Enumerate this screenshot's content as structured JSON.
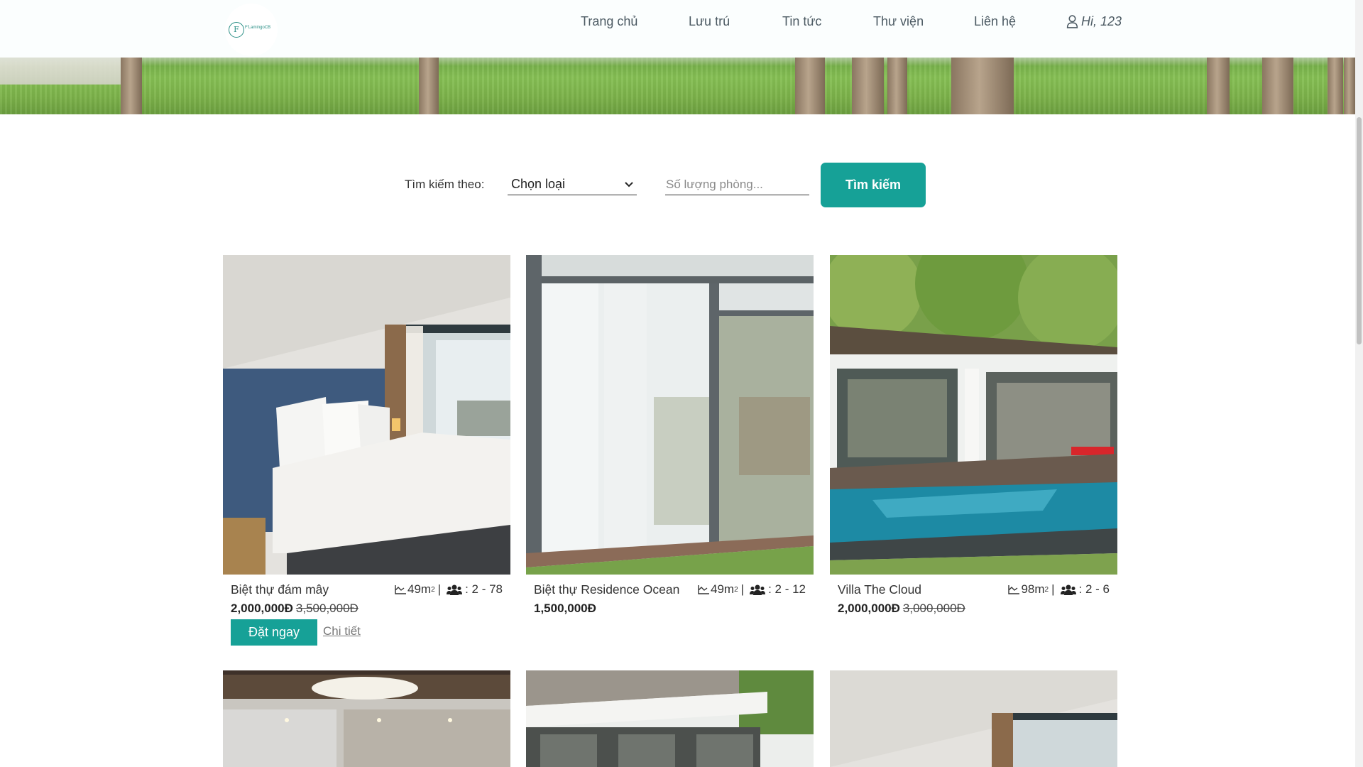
{
  "header": {
    "logo_text": "F'LamingoCB",
    "logo_letter": "F",
    "nav": [
      {
        "label": "Trang chủ"
      },
      {
        "label": "Lưu trú"
      },
      {
        "label": "Tin tức"
      },
      {
        "label": "Thư viện"
      },
      {
        "label": "Liên hệ"
      }
    ],
    "user_greeting": "Hi, 123"
  },
  "search": {
    "label": "Tìm kiếm theo:",
    "type_value": "Chọn loại",
    "rooms_placeholder": "Số lượng phòng...",
    "button_label": "Tìm kiếm"
  },
  "cards": [
    {
      "name": "Biệt thự đám mây",
      "area": "49m",
      "guests": ": 2 - 78",
      "price": "2,000,000Đ",
      "old_price": "3,500,000Đ",
      "book_label": "Đặt ngay",
      "detail_label": "Chi tiết"
    },
    {
      "name": "Biệt thự Residence Ocean",
      "area": "49m",
      "guests": ": 2 - 12",
      "price": "1,500,000Đ",
      "old_price": ""
    },
    {
      "name": "Villa The Cloud",
      "area": "98m",
      "guests": ": 2 - 6",
      "price": "2,000,000Đ",
      "old_price": "3,000,000Đ"
    }
  ],
  "area_unit_sup": "2",
  "separator": "|",
  "colors": {
    "accent": "#16a197",
    "text": "#333333",
    "nav": "#4c5a63"
  }
}
